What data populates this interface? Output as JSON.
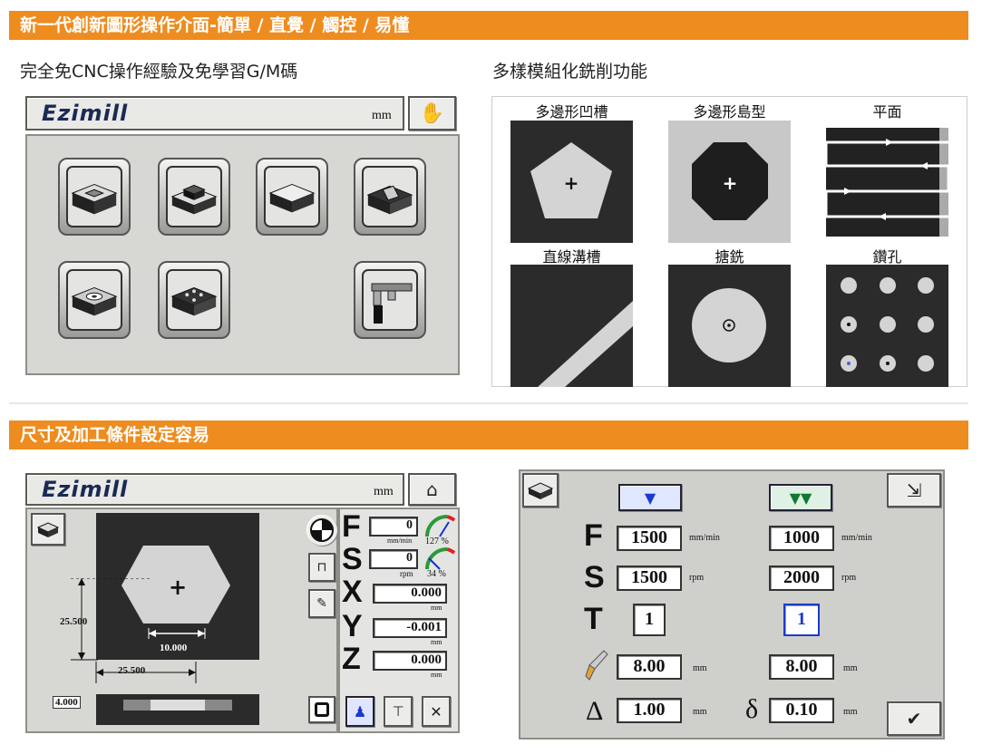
{
  "banner1": "新一代創新圖形操作介面-簡單 / 直覺 / 觸控 / 易懂",
  "banner2": "尺寸及加工條件設定容易",
  "left_subhead": "完全免CNC操作經驗及免學習G/M碼",
  "right_subhead": "多樣模組化銑削功能",
  "brand": "Ezimill",
  "panel1": {
    "unit": "mm",
    "hand_icon": "hand-icon"
  },
  "features": [
    {
      "label": "多邊形凹槽",
      "icon": "pentagon-pocket-icon"
    },
    {
      "label": "多邊形島型",
      "icon": "octagon-island-icon"
    },
    {
      "label": "平面",
      "icon": "face-milling-icon"
    },
    {
      "label": "直線溝槽",
      "icon": "line-slot-icon"
    },
    {
      "label": "搪銑",
      "icon": "boring-icon"
    },
    {
      "label": "鑽孔",
      "icon": "drilling-icon"
    }
  ],
  "panel3": {
    "unit": "mm",
    "home_icon": "home-icon",
    "dims": {
      "height": "25.500",
      "width": "10.000",
      "offset": "25.500",
      "depth": "4.000"
    },
    "F": {
      "label": "F",
      "value": "0",
      "unit": "mm/min",
      "pct": "127 %"
    },
    "S": {
      "label": "S",
      "value": "0",
      "unit": "rpm",
      "pct": "34 %"
    },
    "X": {
      "label": "X",
      "value": "0.000",
      "unit": "mm"
    },
    "Y": {
      "label": "Y",
      "value": "-0.001",
      "unit": "mm"
    },
    "Z": {
      "label": "Z",
      "value": "0.000",
      "unit": "mm"
    }
  },
  "panel4": {
    "F": {
      "label": "F",
      "v1": "1500",
      "u1": "mm/min",
      "v2": "1000",
      "u2": "mm/min"
    },
    "S": {
      "label": "S",
      "v1": "1500",
      "u1": "rpm",
      "v2": "2000",
      "u2": "rpm"
    },
    "T": {
      "label": "T",
      "v1": "1",
      "v2": "1"
    },
    "tool": {
      "v1": "8.00",
      "u1": "mm",
      "v2": "8.00",
      "u2": "mm"
    },
    "delta": {
      "label": "Δ",
      "v1": "1.00",
      "u1": "mm"
    },
    "small_delta": {
      "label": "δ",
      "v2": "0.10",
      "u2": "mm"
    }
  }
}
